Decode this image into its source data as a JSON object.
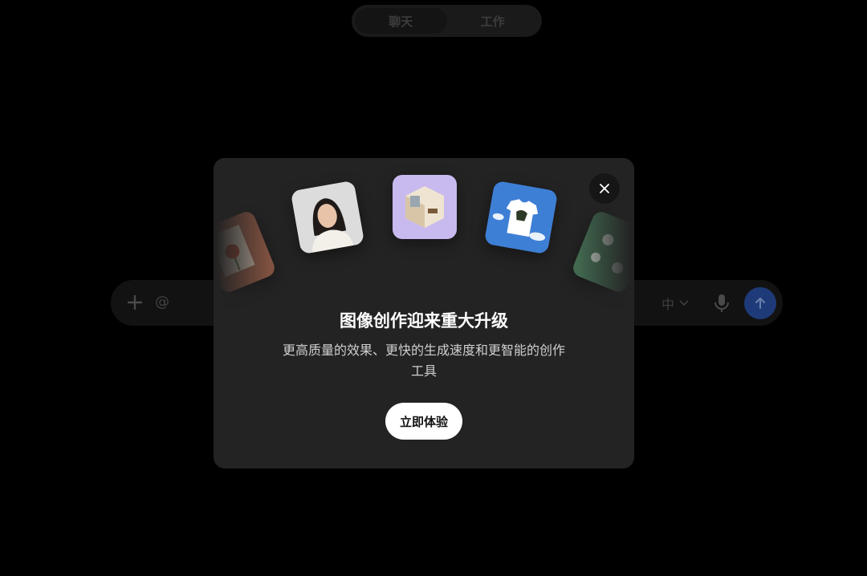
{
  "mode_tabs": [
    {
      "label": "聊天",
      "active": true
    },
    {
      "label": "工作",
      "active": false
    }
  ],
  "chat_bar": {
    "plus_icon": "plus-icon",
    "at_label": "@",
    "language_label": "中",
    "mic_icon": "microphone-icon",
    "send_icon": "arrow-up-icon"
  },
  "modal": {
    "title": "图像创作迎来重大升级",
    "description": "更高质量的效果、更快的生成速度和更智能的创作工具",
    "cta_label": "立即体验",
    "close_icon": "close-icon",
    "thumbnails": [
      "flower-art-thumbnail",
      "portrait-thumbnail",
      "room-3d-thumbnail",
      "tshirt-thumbnail",
      "bunny-pattern-thumbnail"
    ]
  },
  "colors": {
    "background": "#000000",
    "modal_bg": "#232323",
    "send_button": "#1e3a78",
    "cta_bg": "#ffffff"
  }
}
